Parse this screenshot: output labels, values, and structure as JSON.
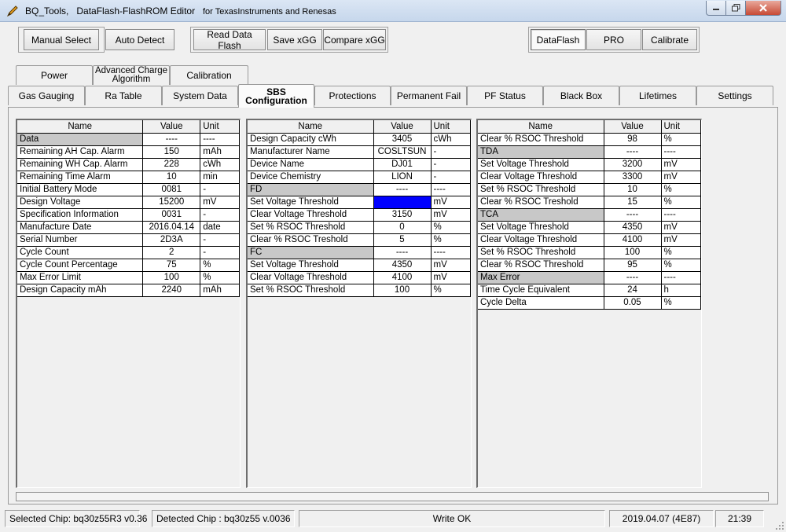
{
  "window": {
    "title": "BQ_Tools,   DataFlash-FlashROM Editor",
    "subtitle": "for TexasInstruments and Renesas",
    "icon": "pen-icon"
  },
  "toolbar": {
    "manual_select": "Manual Select",
    "auto_detect": "Auto Detect",
    "read_data_flash": "Read Data Flash",
    "save_xgg": "Save xGG",
    "compare_xgg": "Compare xGG",
    "dataflash": "DataFlash",
    "pro": "PRO",
    "calibrate": "Calibrate"
  },
  "tabs_top": [
    {
      "label": "Power"
    },
    {
      "label": "Advanced Charge Algorithm"
    },
    {
      "label": "Calibration"
    }
  ],
  "tabs_bottom": [
    {
      "label": "Gas Gauging"
    },
    {
      "label": "Ra Table"
    },
    {
      "label": "System Data"
    },
    {
      "label": "SBS Configuration"
    },
    {
      "label": "Protections"
    },
    {
      "label": "Permanent Fail"
    },
    {
      "label": "PF Status"
    },
    {
      "label": "Black Box"
    },
    {
      "label": "Lifetimes"
    },
    {
      "label": "Settings"
    }
  ],
  "grid_headers": {
    "name": "Name",
    "value": "Value",
    "unit": "Unit"
  },
  "grid1": [
    {
      "name": "Data",
      "value": "----",
      "unit": "----",
      "section": true
    },
    {
      "name": "Remaining AH Cap. Alarm",
      "value": "150",
      "unit": "mAh"
    },
    {
      "name": "Remaining WH Cap. Alarm",
      "value": "228",
      "unit": "cWh"
    },
    {
      "name": "Remaining Time Alarm",
      "value": "10",
      "unit": "min"
    },
    {
      "name": "Initial Battery Mode",
      "value": "0081",
      "unit": "-"
    },
    {
      "name": "Design Voltage",
      "value": "15200",
      "unit": "mV"
    },
    {
      "name": "Specification Information",
      "value": "0031",
      "unit": "-"
    },
    {
      "name": "Manufacture Date",
      "value": "2016.04.14",
      "unit": "date"
    },
    {
      "name": "Serial Number",
      "value": "2D3A",
      "unit": "-"
    },
    {
      "name": "Cycle Count",
      "value": "2",
      "unit": "-"
    },
    {
      "name": "Cycle Count Percentage",
      "value": "75",
      "unit": "%"
    },
    {
      "name": "Max Error Limit",
      "value": "100",
      "unit": "%"
    },
    {
      "name": "Design Capacity mAh",
      "value": "2240",
      "unit": "mAh"
    }
  ],
  "grid2": [
    {
      "name": "Design Capacity cWh",
      "value": "3405",
      "unit": "cWh"
    },
    {
      "name": "Manufacturer Name",
      "value": "COSLTSUN",
      "unit": "-"
    },
    {
      "name": "Device Name",
      "value": "DJ01",
      "unit": "-"
    },
    {
      "name": "Device Chemistry",
      "value": "LION",
      "unit": "-"
    },
    {
      "name": "FD",
      "value": "----",
      "unit": "----",
      "section": true
    },
    {
      "name": "Set Voltage Threshold",
      "value": "",
      "unit": "mV",
      "selected": true
    },
    {
      "name": "Clear Voltage Threshold",
      "value": "3150",
      "unit": "mV"
    },
    {
      "name": "Set % RSOC Threshold",
      "value": "0",
      "unit": "%"
    },
    {
      "name": "Clear % RSOC Treshold",
      "value": "5",
      "unit": "%"
    },
    {
      "name": "FC",
      "value": "----",
      "unit": "----",
      "section": true
    },
    {
      "name": "Set Voltage Threshold",
      "value": "4350",
      "unit": "mV"
    },
    {
      "name": "Clear Voltage Threshold",
      "value": "4100",
      "unit": "mV"
    },
    {
      "name": "Set % RSOC Threshold",
      "value": "100",
      "unit": "%"
    }
  ],
  "grid3": [
    {
      "name": "Clear % RSOC Threshold",
      "value": "98",
      "unit": "%"
    },
    {
      "name": "TDA",
      "value": "----",
      "unit": "----",
      "section": true
    },
    {
      "name": "Set Voltage Threshold",
      "value": "3200",
      "unit": "mV"
    },
    {
      "name": "Clear Voltage Threshold",
      "value": "3300",
      "unit": "mV"
    },
    {
      "name": "Set % RSOC Threshold",
      "value": "10",
      "unit": "%"
    },
    {
      "name": "Clear % RSOC Treshold",
      "value": "15",
      "unit": "%"
    },
    {
      "name": "TCA",
      "value": "----",
      "unit": "----",
      "section": true
    },
    {
      "name": "Set Voltage Threshold",
      "value": "4350",
      "unit": "mV"
    },
    {
      "name": "Clear Voltage Threshold",
      "value": "4100",
      "unit": "mV"
    },
    {
      "name": "Set % RSOC Threshold",
      "value": "100",
      "unit": "%"
    },
    {
      "name": "Clear % RSOC Threshold",
      "value": "95",
      "unit": "%"
    },
    {
      "name": "Max Error",
      "value": "----",
      "unit": "----",
      "section": true
    },
    {
      "name": "Time Cycle Equivalent",
      "value": "24",
      "unit": "h"
    },
    {
      "name": "Cycle Delta",
      "value": "0.05",
      "unit": "%"
    }
  ],
  "status": {
    "selected_chip": "Selected Chip:  bq30z55R3 v0.36",
    "detected_chip": "Detected Chip : bq30z55  v.0036",
    "message": "Write OK",
    "date": "2019.04.07  (4E87)",
    "time": "21:39"
  },
  "colors": {
    "selection": "#0000ff",
    "section_row": "#c8c8c8"
  }
}
